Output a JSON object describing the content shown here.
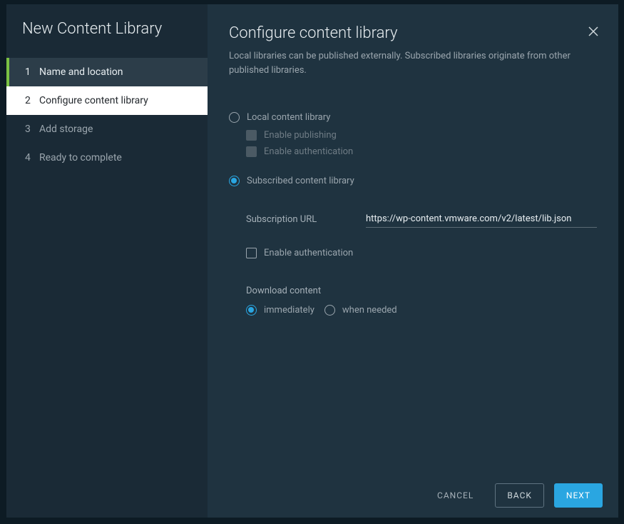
{
  "wizard": {
    "title": "New Content Library",
    "steps": [
      {
        "num": "1",
        "label": "Name and location"
      },
      {
        "num": "2",
        "label": "Configure content library"
      },
      {
        "num": "3",
        "label": "Add storage"
      },
      {
        "num": "4",
        "label": "Ready to complete"
      }
    ]
  },
  "content": {
    "title": "Configure content library",
    "description": "Local libraries can be published externally. Subscribed libraries originate from other published libraries.",
    "local": {
      "label": "Local content library",
      "enable_publishing": "Enable publishing",
      "enable_authentication": "Enable authentication"
    },
    "subscribed": {
      "label": "Subscribed content library",
      "url_label": "Subscription URL",
      "url_value": "https://wp-content.vmware.com/v2/latest/lib.json",
      "enable_authentication": "Enable authentication",
      "download_label": "Download content",
      "option_immediately": "immediately",
      "option_when_needed": "when needed"
    }
  },
  "footer": {
    "cancel": "CANCEL",
    "back": "BACK",
    "next": "NEXT"
  }
}
